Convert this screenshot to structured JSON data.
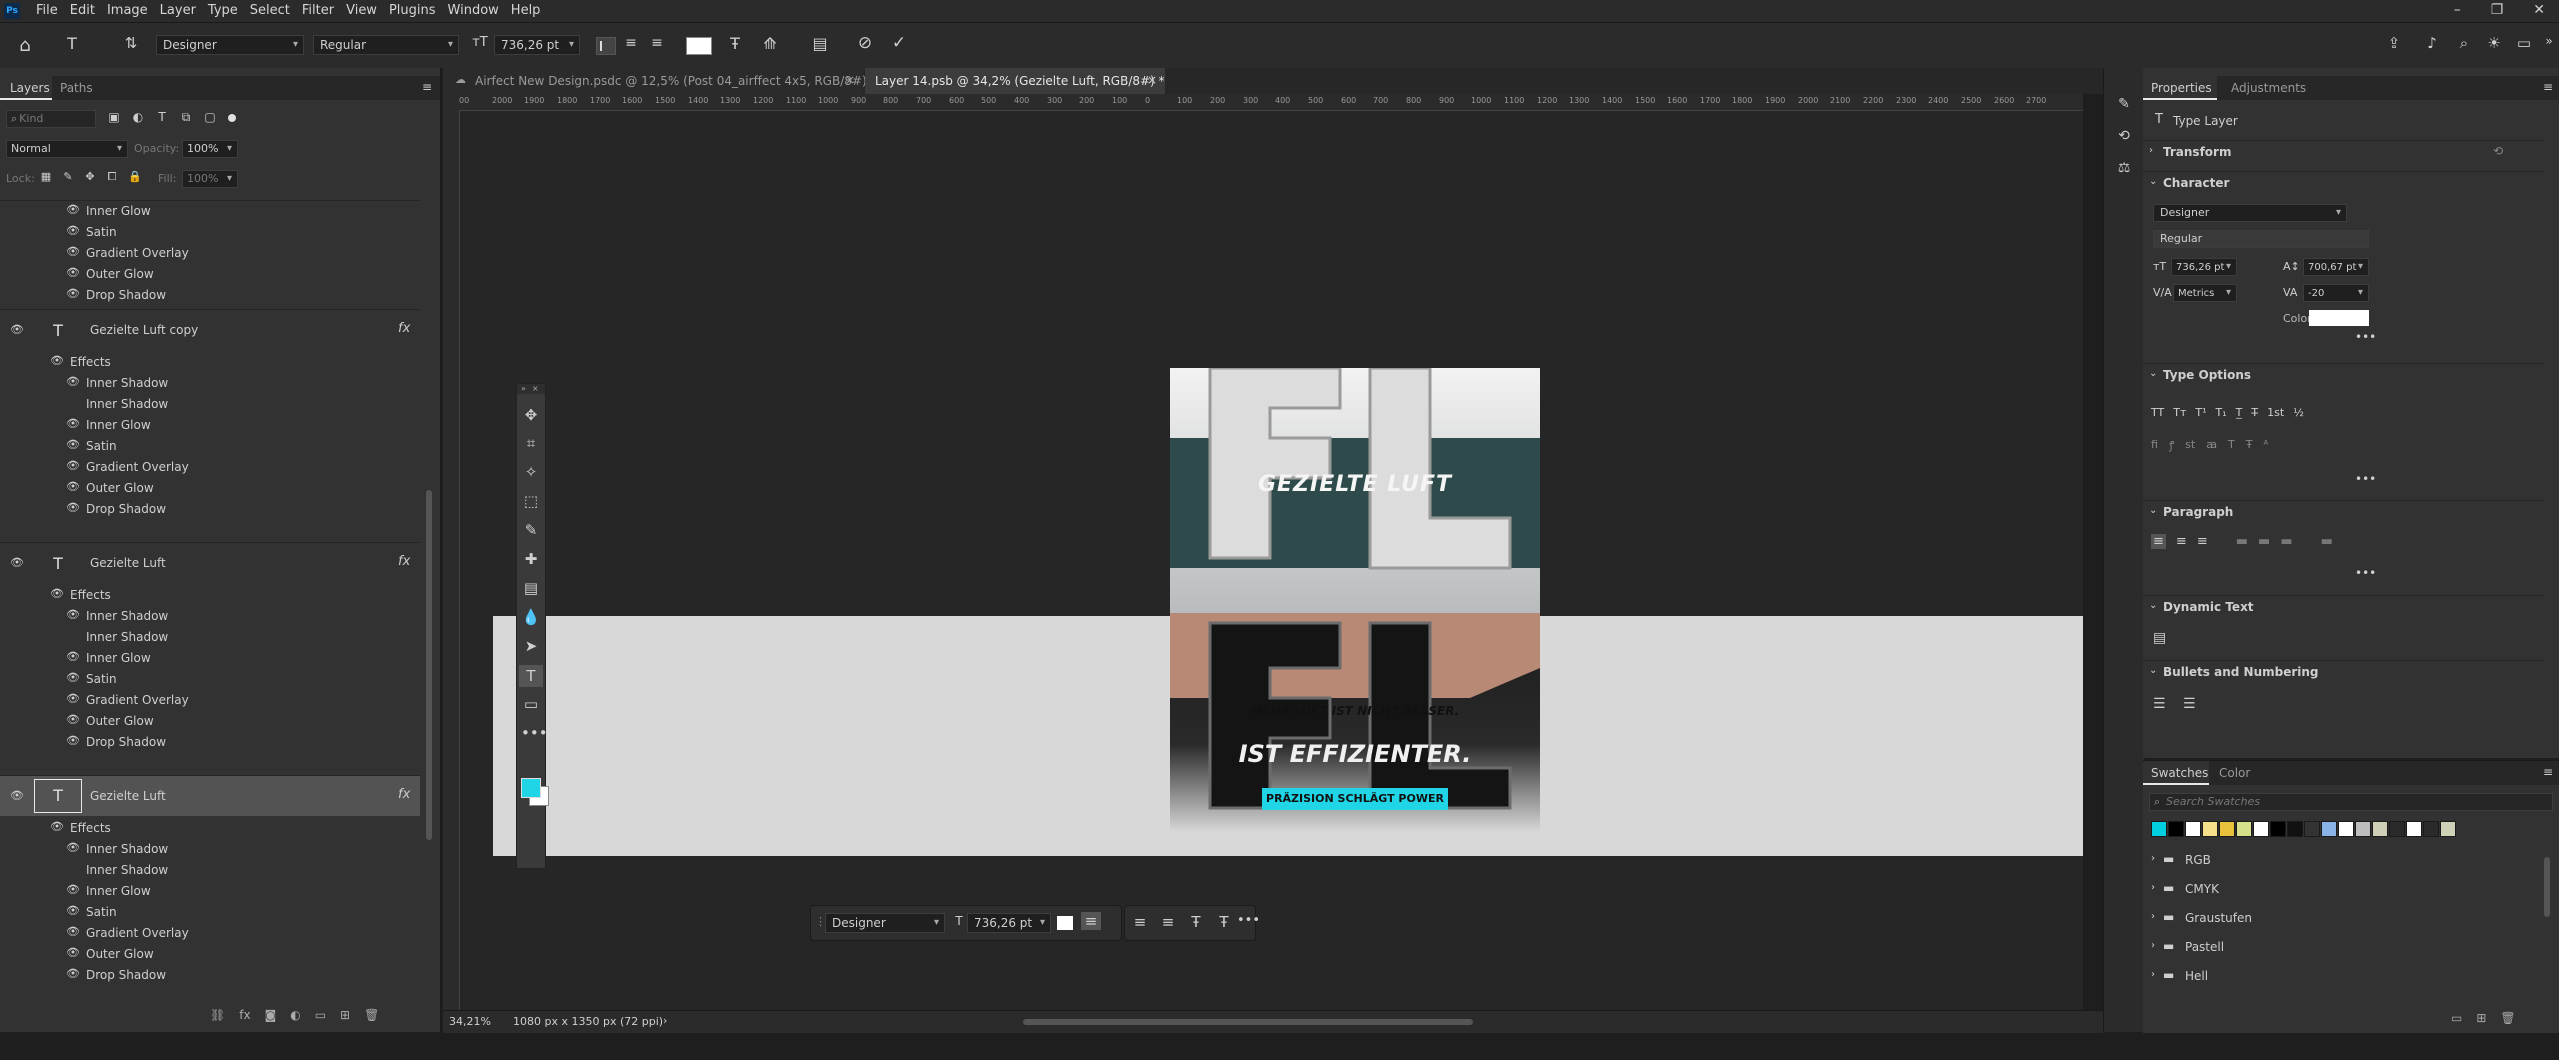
{
  "app": {
    "logo": "Ps"
  },
  "menu": [
    "File",
    "Edit",
    "Image",
    "Layer",
    "Type",
    "Select",
    "Filter",
    "View",
    "Plugins",
    "Window",
    "Help"
  ],
  "window_controls": {
    "minimize": "–",
    "restore": "❐",
    "close": "✕"
  },
  "options": {
    "font_family": "Designer",
    "font_style": "Regular",
    "font_size": "736,26 pt",
    "cancel_icon": "cancel-icon",
    "commit_icon": "commit-icon"
  },
  "doc_tabs": [
    {
      "label": "Airfect New Design.psdc @ 12,5% (Post 04_airffect 4x5, RGB/8#)",
      "close": "×"
    },
    {
      "label": "Layer 14.psb @ 34,2% (Gezielte Luft, RGB/8#) *",
      "close": "×"
    }
  ],
  "ruler_labels": [
    "00",
    "2000",
    "1900",
    "1800",
    "1700",
    "1600",
    "1500",
    "1400",
    "1300",
    "1200",
    "1100",
    "1000",
    "900",
    "800",
    "700",
    "600",
    "500",
    "400",
    "300",
    "200",
    "100",
    "0",
    "100",
    "200",
    "300",
    "400",
    "500",
    "600",
    "700",
    "800",
    "900",
    "1000",
    "1100",
    "1200",
    "1300",
    "1400",
    "1500",
    "1600",
    "1700",
    "1800",
    "1900",
    "2000",
    "2100",
    "2200",
    "2300",
    "2400",
    "2500",
    "2600",
    "2700"
  ],
  "layers_panel": {
    "tabs": [
      "Layers",
      "Paths"
    ],
    "filter_placeholder": "Kind",
    "blend_mode": "Normal",
    "opacity_label": "Opacity:",
    "opacity_value": "100%",
    "lock_label": "Lock:",
    "fill_label": "Fill:",
    "fill_value": "100%",
    "top_effects": [
      "Inner Glow",
      "Satin",
      "Gradient Overlay",
      "Outer Glow",
      "Drop Shadow"
    ],
    "layers": [
      {
        "name": "Gezielte Luft copy",
        "effects_label": "Effects",
        "effects": [
          "Inner Shadow",
          "Inner Shadow",
          "Inner Glow",
          "Satin",
          "Gradient Overlay",
          "Outer Glow",
          "Drop Shadow"
        ],
        "fx": "fx"
      },
      {
        "name": "Gezielte Luft",
        "effects_label": "Effects",
        "effects": [
          "Inner Shadow",
          "Inner Shadow",
          "Inner Glow",
          "Satin",
          "Gradient Overlay",
          "Outer Glow",
          "Drop Shadow"
        ],
        "fx": "fx"
      },
      {
        "name": "Gezielte Luft",
        "effects_label": "Effects",
        "effects": [
          "Inner Shadow",
          "Inner Shadow",
          "Inner Glow",
          "Satin",
          "Gradient Overlay",
          "Outer Glow",
          "Drop Shadow"
        ],
        "fx": "fx"
      }
    ]
  },
  "status": {
    "zoom": "34,21%",
    "doc_info": "1080 px x 1350 px (72 ppi)"
  },
  "artwork": {
    "headline1": "GEZIELTE LUFT",
    "line2": "MEHR LUFT IST NICHT BESSER.",
    "line3": "IST EFFIZIENTER.",
    "badge": "PRÄZISION SCHLÄGT POWER"
  },
  "context_bar": {
    "font_family": "Designer",
    "font_size": "736,26 pt"
  },
  "properties": {
    "tabs": [
      "Properties",
      "Adjustments"
    ],
    "layer_type": "Type Layer",
    "transform": "Transform",
    "character": "Character",
    "font_family": "Designer",
    "font_style": "Regular",
    "size": "736,26 pt",
    "leading": "700,67 pt",
    "kerning": "Metrics",
    "tracking": "-20",
    "color_label": "Color",
    "type_options": "Type Options",
    "paragraph": "Paragraph",
    "dynamic_text": "Dynamic Text",
    "bullets": "Bullets and Numbering"
  },
  "swatches": {
    "tabs": [
      "Swatches",
      "Color"
    ],
    "search_placeholder": "Search Swatches",
    "colors": [
      "#00d0e0",
      "#000000",
      "#ffffff",
      "#f7e08a",
      "#e8c23a",
      "#d6e08a",
      "#ffffff",
      "#000000",
      "#111111",
      "#333333",
      "#8ab4e8",
      "#ffffff",
      "#bdbdbd",
      "#cfcfb8",
      "#2a2a2a",
      "#ffffff",
      "#2a2a2a",
      "#d0d2b8"
    ],
    "groups": [
      "RGB",
      "CMYK",
      "Graustufen",
      "Pastell",
      "Hell"
    ]
  },
  "colors": {
    "accent": "#31a8ff",
    "foreground": "#1fd5e6",
    "background": "#ffffff"
  }
}
